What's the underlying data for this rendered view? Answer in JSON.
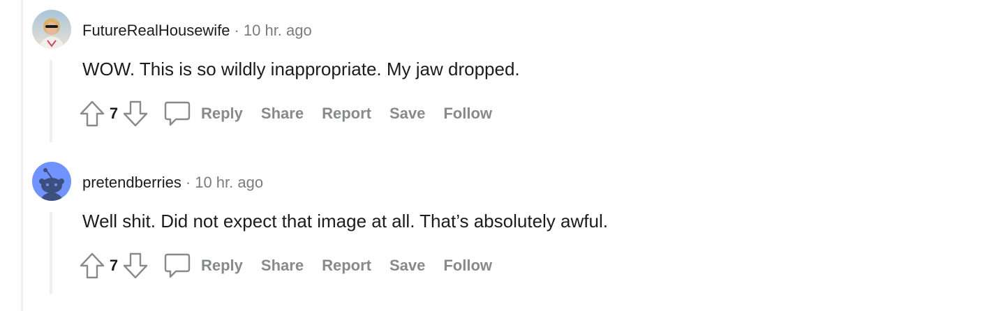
{
  "comments": [
    {
      "username": "FutureRealHousewife",
      "separator": "·",
      "time": "10 hr. ago",
      "body": "WOW. This is so wildly inappropriate. My jaw dropped.",
      "score": "7",
      "actions": {
        "reply": "Reply",
        "share": "Share",
        "report": "Report",
        "save": "Save",
        "follow": "Follow"
      }
    },
    {
      "username": "pretendberries",
      "separator": "·",
      "time": "10 hr. ago",
      "body": "Well shit. Did not expect that image at all. That’s absolutely awful.",
      "score": "7",
      "actions": {
        "reply": "Reply",
        "share": "Share",
        "report": "Report",
        "save": "Save",
        "follow": "Follow"
      }
    }
  ],
  "icons": {
    "upvote": "upvote-arrow-icon",
    "downvote": "downvote-arrow-icon",
    "reply": "speech-bubble-icon",
    "avatar1": "user-photo-avatar",
    "avatar2": "snoo-avatar"
  },
  "colors": {
    "text": "#1c1c1c",
    "meta": "#7c7c7c",
    "action": "#878a8c",
    "rail": "#edeff1",
    "snoo_bg": "#7193ff"
  }
}
